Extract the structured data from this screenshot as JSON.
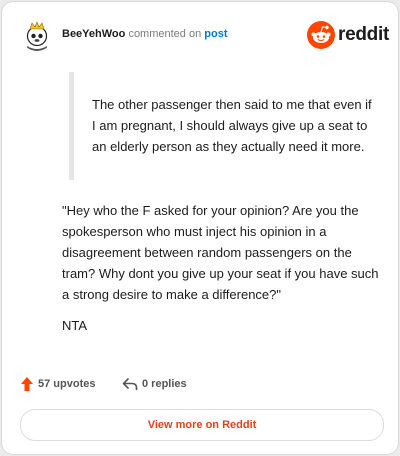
{
  "header": {
    "username": "BeeYehWoo",
    "verb": "commented on",
    "post_link": "post",
    "brand": "reddit"
  },
  "comment": {
    "quote": "The other passenger then said to me that even if I am pregnant, I should always give up a seat to an elderly person as they actually need it more.",
    "paragraphs": [
      "\"Hey who the F asked for your opinion? Are you the spokesperson who must inject his opinion in a disagreement between random passengers on the tram? Why dont you give up your seat if you have such a strong desire to make a difference?\"",
      "NTA"
    ]
  },
  "actions": {
    "upvotes": "57 upvotes",
    "replies": "0 replies"
  },
  "footer": {
    "view_more": "View more on Reddit"
  },
  "colors": {
    "brand_orange": "#ff4500",
    "link_blue": "#0079d3",
    "button_text": "#e0411f"
  },
  "icons": [
    "avatar",
    "reddit-logo-icon",
    "upvote-arrow-icon",
    "reply-arrow-icon"
  ]
}
